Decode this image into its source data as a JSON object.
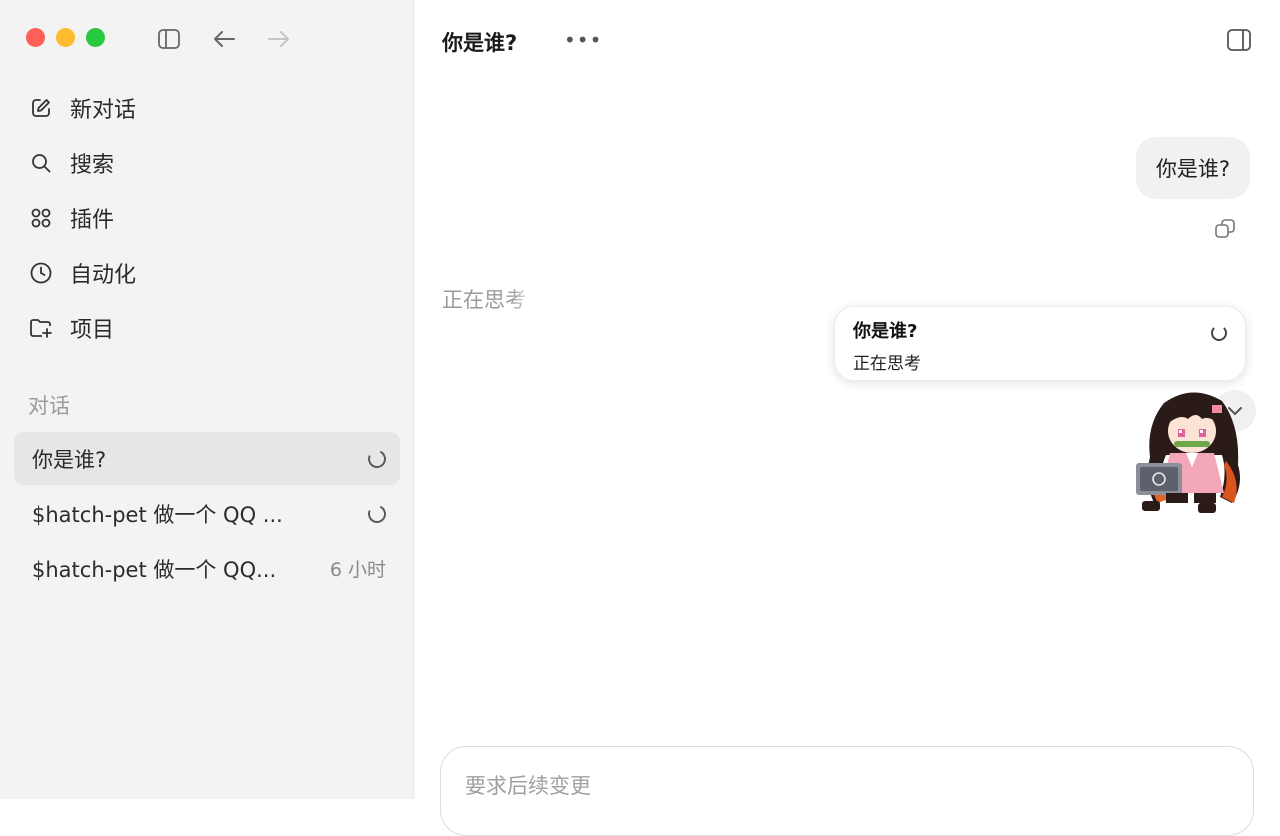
{
  "sidebar": {
    "nav": [
      {
        "label": "新对话",
        "icon": "compose-icon"
      },
      {
        "label": "搜索",
        "icon": "search-icon"
      },
      {
        "label": "插件",
        "icon": "grid-icon"
      },
      {
        "label": "自动化",
        "icon": "clock-icon"
      },
      {
        "label": "项目",
        "icon": "folder-add-icon"
      }
    ],
    "section_label": "对话",
    "conversations": [
      {
        "title": "你是谁?",
        "meta": ""
      },
      {
        "title": "$hatch-pet 做一个 QQ ...",
        "meta": ""
      },
      {
        "title": "$hatch-pet 做一个 QQ...",
        "meta": "6 小时"
      }
    ]
  },
  "main": {
    "title": "你是谁?",
    "more_label": "•••",
    "user_message": "你是谁?",
    "thinking_text": "正在思考",
    "popup": {
      "title": "你是谁?",
      "subtitle": "正在思考"
    },
    "composer_placeholder": "要求后续变更"
  },
  "colors": {
    "sidebar_bg": "#f3f3f4",
    "active_row": "#e6e6e8",
    "close": "#fe5f57",
    "minimize": "#febc2e",
    "zoom": "#28c840"
  }
}
